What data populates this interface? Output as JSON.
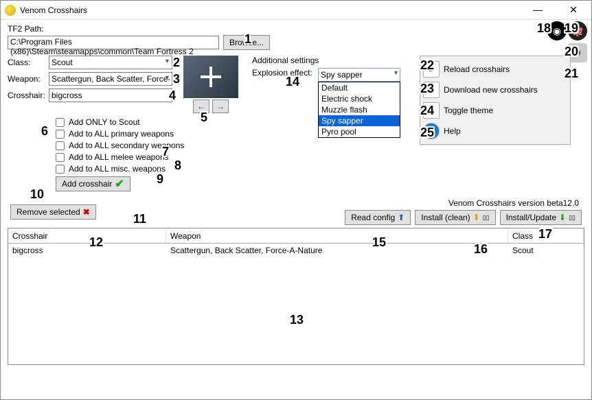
{
  "window": {
    "title": "Venom Crosshairs"
  },
  "path": {
    "label": "TF2 Path:",
    "value": "C:\\Program Files (x86)\\Steam\\steamapps\\common\\Team Fortress 2",
    "browse": "Browse..."
  },
  "form": {
    "class_label": "Class:",
    "class_value": "Scout",
    "weapon_label": "Weapon:",
    "weapon_value": "Scattergun, Back Scatter, Force-A",
    "crosshair_label": "Crosshair:",
    "crosshair_value": "bigcross"
  },
  "additional": {
    "heading": "Additional settings",
    "explosion_label": "Explosion effect:",
    "explosion_selected": "Spy sapper",
    "options": [
      "Default",
      "Electric shock",
      "Muzzle flash",
      "Spy sapper",
      "Pyro pool"
    ]
  },
  "side": {
    "reload": "Reload crosshairs",
    "download": "Download new crosshairs",
    "theme": "Toggle theme",
    "help": "Help"
  },
  "checks": {
    "only": "Add ONLY to Scout",
    "primary": "Add to ALL primary weapons",
    "secondary": "Add to ALL secondary weapons",
    "melee": "Add to ALL melee weapons",
    "misc": "Add to ALL misc. weapons"
  },
  "buttons": {
    "add": "Add crosshair",
    "remove": "Remove selected",
    "read": "Read config",
    "install_clean": "Install (clean)",
    "install_update": "Install/Update"
  },
  "version": "Venom Crosshairs version beta12.0",
  "table": {
    "headers": {
      "c1": "Crosshair",
      "c2": "Weapon",
      "c3": "Class"
    },
    "rows": [
      {
        "c1": "bigcross",
        "c2": "Scattergun, Back Scatter, Force-A-Nature",
        "c3": "Scout"
      }
    ]
  },
  "badges": {
    "1": "1",
    "2": "2",
    "3": "3",
    "4": "4",
    "5": "5",
    "6": "6",
    "7": "7",
    "8": "8",
    "9": "9",
    "10": "10",
    "11": "11",
    "12": "12",
    "13": "13",
    "14": "14",
    "15": "15",
    "16": "16",
    "17": "17",
    "18": "18",
    "19": "19",
    "20": "20",
    "21": "21",
    "22": "22",
    "23": "23",
    "24": "24",
    "25": "25"
  }
}
